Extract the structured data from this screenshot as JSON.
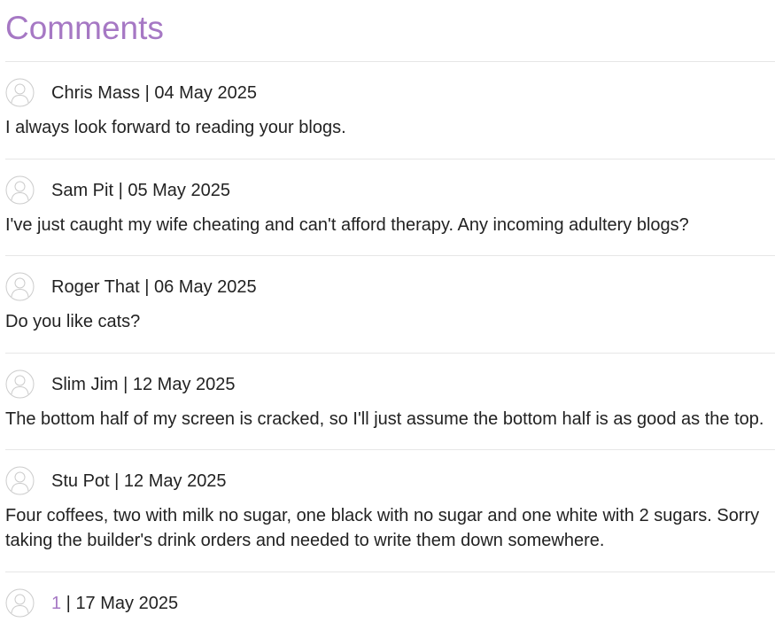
{
  "page": {
    "title": "Comments",
    "accent_color": "#a678c4"
  },
  "comments": [
    {
      "author": "Chris Mass",
      "date": "04 May 2025",
      "text": "I always look forward to reading your blogs.",
      "avatar_icon": "user-avatar-icon"
    },
    {
      "author": "Sam Pit",
      "date": "05 May 2025",
      "text": "I've just caught my wife cheating and can't afford therapy. Any incoming adultery blogs?",
      "avatar_icon": "user-avatar-icon"
    },
    {
      "author": "Roger That",
      "date": "06 May 2025",
      "text": "Do you like cats?",
      "avatar_icon": "user-avatar-icon"
    },
    {
      "author": "Slim Jim",
      "date": "12 May 2025",
      "text": "The bottom half of my screen is cracked, so I'll just assume the bottom half is as good as the top.",
      "avatar_icon": "user-avatar-icon"
    },
    {
      "author": "Stu Pot",
      "date": "12 May 2025",
      "text": "Four coffees, two with milk no sugar, one black with no sugar and one white with 2 sugars. Sorry taking the builder's drink orders and needed to write them down somewhere.",
      "avatar_icon": "user-avatar-icon"
    },
    {
      "author": "1",
      "date": "17 May 2025",
      "text": "",
      "avatar_icon": "user-avatar-icon",
      "author_is_link": true
    }
  ],
  "separator": " | "
}
